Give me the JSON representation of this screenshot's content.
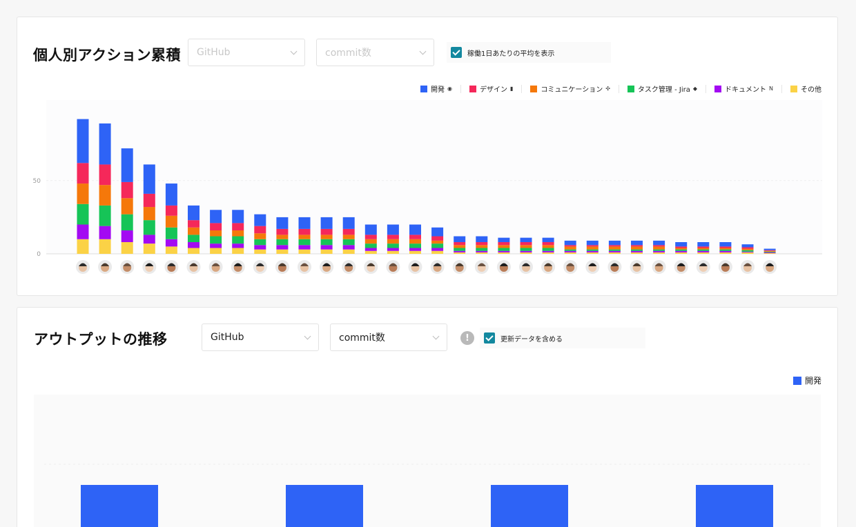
{
  "panel1": {
    "title": "個人別アクション累積",
    "source_select": "GitHub",
    "metric_select": "commit数",
    "checkbox_label": "稼働1日あたりの平均を表示",
    "checkbox_checked": true
  },
  "panel2": {
    "title": "アウトプットの推移",
    "source_select": "GitHub",
    "metric_select": "commit数",
    "info_icon": "info-icon",
    "checkbox_label": "更新データを含める",
    "checkbox_checked": true,
    "legend_label": "開発"
  },
  "colors": {
    "dev": "#2e63f6",
    "design": "#f5285a",
    "communication": "#f5780a",
    "task": "#16c457",
    "document": "#a30af2",
    "other": "#fbd246",
    "checkbox": "#13889f"
  },
  "legend": [
    {
      "label": "開発",
      "color": "#2e63f6",
      "icon": "github-icon",
      "glyph": "◉"
    },
    {
      "label": "デザイン",
      "color": "#f5285a",
      "icon": "figma-icon",
      "glyph": "▮"
    },
    {
      "label": "コミュニケーション",
      "color": "#f5780a",
      "icon": "slack-icon",
      "glyph": "✣"
    },
    {
      "label": "タスク管理 - Jira",
      "color": "#16c457",
      "icon": "jira-icon",
      "glyph": "◆"
    },
    {
      "label": "ドキュメント",
      "color": "#a30af2",
      "icon": "notion-icon",
      "glyph": "N"
    },
    {
      "label": "その他",
      "color": "#fbd246",
      "icon": "",
      "glyph": ""
    }
  ],
  "chart_data": [
    {
      "type": "bar",
      "stacked": true,
      "title": "",
      "xlabel": "",
      "ylabel": "",
      "ylim": [
        0,
        105
      ],
      "yticks": [
        0,
        50
      ],
      "x_axis": "avatars",
      "categories": [
        "1",
        "2",
        "3",
        "4",
        "5",
        "6",
        "7",
        "8",
        "9",
        "10",
        "11",
        "12",
        "13",
        "14",
        "15",
        "16",
        "17",
        "18",
        "19",
        "20",
        "21",
        "22",
        "23",
        "24",
        "25",
        "26",
        "27",
        "28",
        "29",
        "30",
        "31",
        "32"
      ],
      "series": [
        {
          "name": "その他",
          "values": [
            10,
            10,
            8,
            7,
            5,
            4,
            4,
            4,
            3,
            3,
            3,
            3,
            3,
            2,
            2,
            2,
            2,
            1,
            1,
            1,
            1,
            1,
            1,
            1,
            1,
            1,
            1,
            1,
            1,
            1,
            1,
            0.5
          ]
        },
        {
          "name": "ドキュメント",
          "values": [
            10,
            9,
            8,
            6,
            5,
            4,
            3,
            3,
            3,
            3,
            3,
            3,
            3,
            2,
            2,
            2,
            2,
            1,
            1,
            1,
            1,
            1,
            1,
            1,
            1,
            1,
            1,
            1,
            1,
            1,
            0.5,
            0.5
          ]
        },
        {
          "name": "タスク管理 - Jira",
          "values": [
            14,
            14,
            11,
            10,
            8,
            5,
            5,
            5,
            4,
            4,
            4,
            4,
            4,
            3,
            3,
            3,
            3,
            2,
            2,
            2,
            2,
            2,
            1,
            1,
            1,
            1,
            1,
            1,
            1,
            1,
            1,
            0.5
          ]
        },
        {
          "name": "コミュニケーション",
          "values": [
            14,
            14,
            11,
            9,
            8,
            5,
            4,
            4,
            4,
            3,
            3,
            3,
            3,
            3,
            3,
            3,
            2,
            2,
            2,
            2,
            2,
            2,
            2,
            2,
            2,
            2,
            2,
            1,
            1,
            1,
            1,
            0.5
          ]
        },
        {
          "name": "デザイン",
          "values": [
            14,
            14,
            11,
            9,
            7,
            5,
            5,
            5,
            5,
            4,
            4,
            4,
            4,
            3,
            3,
            3,
            3,
            2,
            2,
            2,
            2,
            2,
            1,
            1,
            1,
            1,
            1,
            1,
            1,
            1,
            1,
            0.5
          ]
        },
        {
          "name": "開発",
          "values": [
            30,
            28,
            23,
            20,
            15,
            10,
            9,
            9,
            8,
            8,
            8,
            8,
            8,
            7,
            7,
            7,
            6,
            4,
            4,
            3,
            3,
            3,
            3,
            3,
            3,
            3,
            3,
            3,
            3,
            3,
            2,
            1
          ]
        }
      ],
      "grid": true,
      "legend_position": "top-right"
    },
    {
      "type": "bar",
      "title": "",
      "xlabel": "",
      "ylabel": "",
      "series": [
        {
          "name": "開発",
          "values": [
            100,
            100,
            100,
            100
          ]
        }
      ],
      "grid": true,
      "legend_position": "top-right"
    }
  ]
}
